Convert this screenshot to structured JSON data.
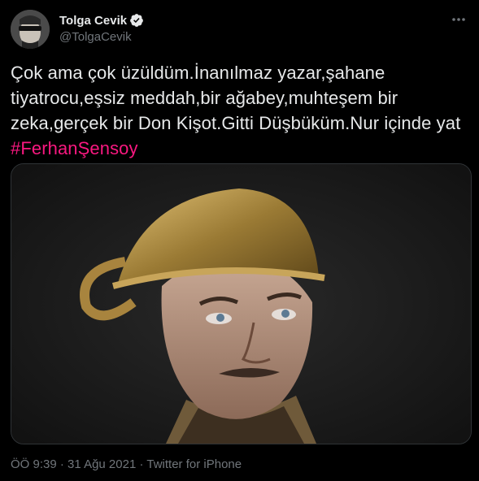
{
  "author": {
    "display_name": "Tolga Cevik",
    "handle": "@TolgaCevik",
    "verified": true
  },
  "icons": {
    "verified": "verified-badge-icon",
    "more": "more-dots-icon"
  },
  "tweet": {
    "text": "Çok ama çok üzüldüm.İnanılmaz yazar,şahane tiyatrocu,eşsiz meddah,bir ağabey,muhteşem bir zeka,gerçek bir Don Kişot.Gitti Düşbüküm.Nur içinde yat ",
    "hashtag": "#FerhanŞensoy"
  },
  "meta": {
    "time": "ÖÖ 9:39",
    "sep1": " · ",
    "date": "31 Ağu 2021",
    "sep2": " · ",
    "source": "Twitter for iPhone"
  },
  "colors": {
    "background": "#000000",
    "hashtag": "#f91880",
    "verified": "#1d9bf0",
    "secondary_text": "#71767b"
  }
}
